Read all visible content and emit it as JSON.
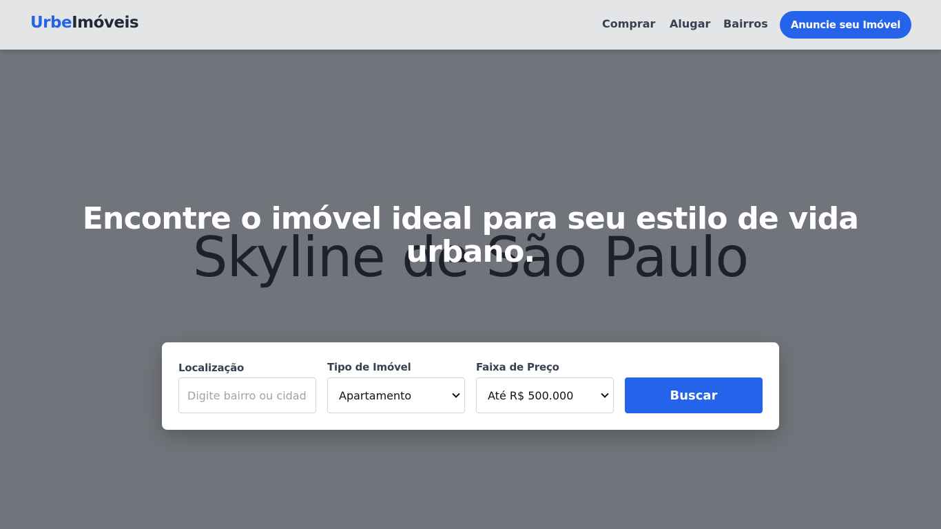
{
  "brand": {
    "part1": "Urbe",
    "part2": "Imóveis"
  },
  "nav": {
    "links": [
      {
        "label": "Comprar"
      },
      {
        "label": "Alugar"
      },
      {
        "label": "Bairros"
      }
    ],
    "cta_label": "Anuncie seu Imóvel"
  },
  "hero": {
    "background_alt_text": "Skyline de São Paulo",
    "headline": "Encontre o imóvel ideal para seu estilo de vida urbano."
  },
  "search": {
    "location": {
      "label": "Localização",
      "placeholder": "Digite bairro ou cidade",
      "value": ""
    },
    "type": {
      "label": "Tipo de Imóvel",
      "selected": "Apartamento"
    },
    "price": {
      "label": "Faixa de Preço",
      "selected": "Até R$ 500.000"
    },
    "button_label": "Buscar"
  },
  "colors": {
    "accent": "#2563eb",
    "topbar_bg": "#e4e5e7",
    "hero_overlay": "#71747a"
  }
}
